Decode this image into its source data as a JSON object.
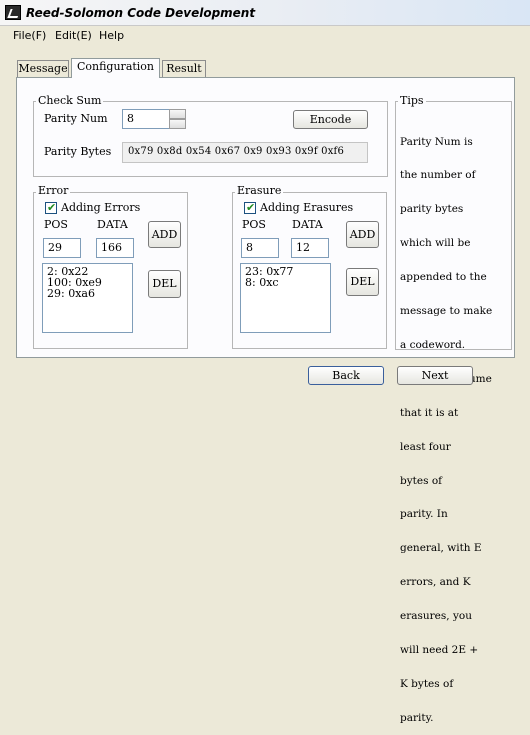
{
  "window": {
    "title": "Reed-Solomon Code Development"
  },
  "menu": {
    "file": "File(F)",
    "edit": "Edit(E)",
    "help": "Help"
  },
  "tabs": [
    {
      "label": "Message"
    },
    {
      "label": "Configuration",
      "active": true
    },
    {
      "label": "Result"
    }
  ],
  "checksum": {
    "legend": "Check Sum",
    "parity_num_label": "Parity Num",
    "parity_num_value": "8",
    "encode_label": "Encode",
    "parity_bytes_label": "Parity Bytes",
    "parity_bytes_value": "0x79 0x8d 0x54 0x67 0x9 0x93 0x9f 0xf6"
  },
  "error": {
    "legend": "Error",
    "checkbox_label": "Adding Errors",
    "checked": true,
    "pos_label": "POS",
    "data_label": "DATA",
    "pos_value": "29",
    "data_value": "166",
    "add_label": "ADD",
    "del_label": "DEL",
    "items": [
      "2: 0x22",
      "100: 0xe9",
      "29: 0xa6"
    ]
  },
  "erasure": {
    "legend": "Erasure",
    "checkbox_label": "Adding Erasures",
    "checked": true,
    "pos_label": "POS",
    "data_label": "DATA",
    "pos_value": "8",
    "data_value": "12",
    "add_label": "ADD",
    "del_label": "DEL",
    "items": [
      "23: 0x77",
      "8: 0xc"
    ]
  },
  "tips": {
    "legend": "Tips",
    "lines": [
      "Parity Num is",
      "the number of",
      "parity bytes",
      "which will be",
      "appended to the",
      "message to make",
      "a codeword.",
      "Here, we assume",
      "that it is at",
      "least four",
      "bytes of",
      "parity. In",
      "general, with E",
      "errors, and K",
      "erasures, you",
      "will need 2E +",
      "K bytes of",
      "parity."
    ]
  },
  "footer": {
    "back_label": "Back",
    "next_label": "Next"
  }
}
